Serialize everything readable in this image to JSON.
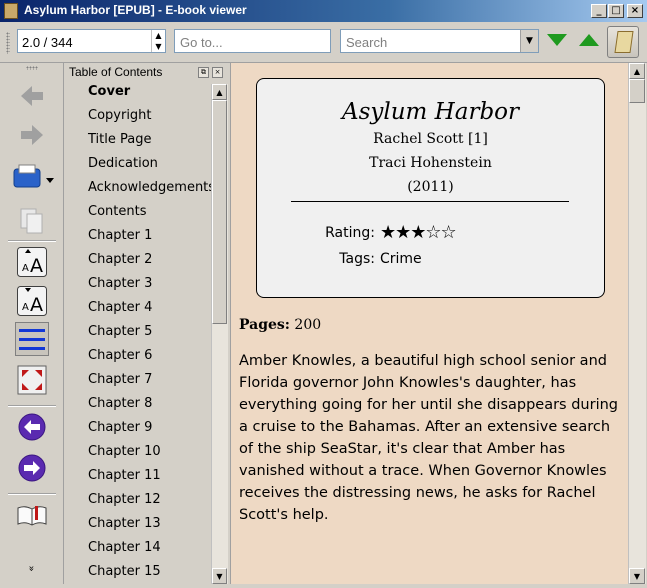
{
  "window": {
    "title": "Asylum Harbor [EPUB] - E-book viewer",
    "controls": [
      "_",
      "□",
      "×"
    ]
  },
  "toolbar": {
    "position_value": "2.0 / 344",
    "goto_placeholder": "Go to...",
    "search_placeholder": "Search",
    "find_next_color": "#1f9a1f",
    "find_prev_color": "#1f9a1f"
  },
  "left_toolbar": {
    "icons": [
      "back-icon",
      "forward-icon",
      "print-icon",
      "copy-icon",
      "font-larger-icon",
      "font-smaller-icon",
      "toc-icon",
      "fullscreen-icon",
      "previous-page-icon",
      "next-page-icon",
      "bookmark-icon"
    ],
    "more": "»"
  },
  "toc": {
    "header": "Table of Contents",
    "items": [
      {
        "label": "Cover",
        "bold": true
      },
      {
        "label": "Copyright"
      },
      {
        "label": "Title Page"
      },
      {
        "label": "Dedication"
      },
      {
        "label": "Acknowledgements"
      },
      {
        "label": "Contents"
      },
      {
        "label": "Chapter 1"
      },
      {
        "label": "Chapter 2"
      },
      {
        "label": "Chapter 3"
      },
      {
        "label": "Chapter 4"
      },
      {
        "label": "Chapter 5"
      },
      {
        "label": "Chapter 6"
      },
      {
        "label": "Chapter 7"
      },
      {
        "label": "Chapter 8"
      },
      {
        "label": "Chapter 9"
      },
      {
        "label": "Chapter 10"
      },
      {
        "label": "Chapter 11"
      },
      {
        "label": "Chapter 12"
      },
      {
        "label": "Chapter 13"
      },
      {
        "label": "Chapter 14"
      },
      {
        "label": "Chapter 15"
      }
    ]
  },
  "book": {
    "title": "Asylum Harbor",
    "series": "Rachel Scott [1]",
    "author": "Traci Hohenstein",
    "year": "(2011)",
    "rating_label": "Rating:",
    "rating_stars": "★★★☆☆",
    "rating_value": 3,
    "rating_max": 5,
    "tags_label": "Tags:",
    "tags": "Crime",
    "pages_label": "Pages:",
    "pages": "200",
    "description": "Amber Knowles, a beautiful high school senior and Florida governor John Knowles's daughter, has everything going for her until she disappears during a cruise to the Bahamas. After an extensive search of the ship SeaStar, it's clear that Amber has vanished without a trace. When Governor Knowles receives the distressing news, he asks for Rachel Scott's help."
  }
}
